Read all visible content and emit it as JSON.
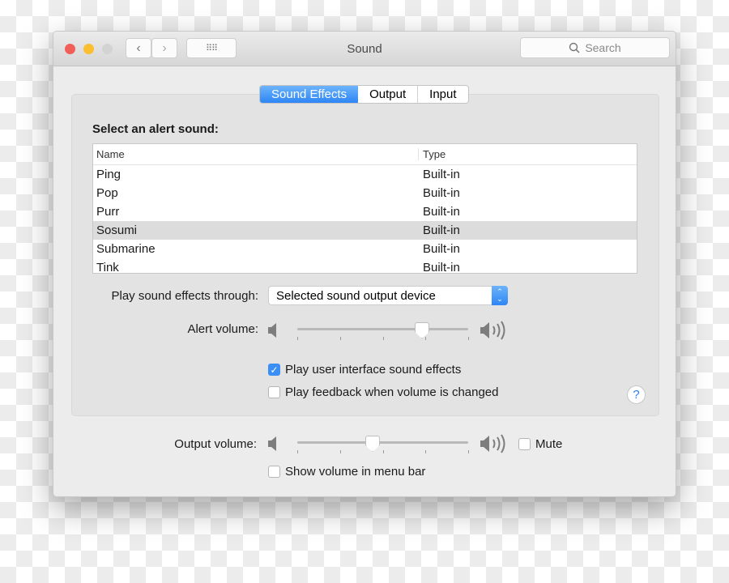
{
  "window": {
    "title": "Sound",
    "search_placeholder": "Search"
  },
  "tabs": [
    {
      "label": "Sound Effects",
      "active": true
    },
    {
      "label": "Output",
      "active": false
    },
    {
      "label": "Input",
      "active": false
    }
  ],
  "alert_sound": {
    "heading": "Select an alert sound:",
    "columns": [
      "Name",
      "Type"
    ],
    "rows": [
      {
        "name": "Ping",
        "type": "Built-in"
      },
      {
        "name": "Pop",
        "type": "Built-in"
      },
      {
        "name": "Purr",
        "type": "Built-in"
      },
      {
        "name": "Sosumi",
        "type": "Built-in",
        "selected": true
      },
      {
        "name": "Submarine",
        "type": "Built-in"
      },
      {
        "name": "Tink",
        "type": "Built-in"
      }
    ]
  },
  "play_through": {
    "label": "Play sound effects through:",
    "value": "Selected sound output device"
  },
  "alert_volume": {
    "label": "Alert volume:",
    "level": 0.73
  },
  "checkboxes": {
    "ui_sounds": {
      "label": "Play user interface sound effects",
      "checked": true
    },
    "feedback": {
      "label": "Play feedback when volume is changed",
      "checked": false
    }
  },
  "help": "?",
  "output_volume": {
    "label": "Output volume:",
    "level": 0.44
  },
  "mute": {
    "label": "Mute",
    "checked": false
  },
  "menu_bar": {
    "label": "Show volume in menu bar",
    "checked": false
  },
  "colors": {
    "accent": "#3b8ef5",
    "close": "#f25f58",
    "minimize": "#fbbe2e"
  }
}
